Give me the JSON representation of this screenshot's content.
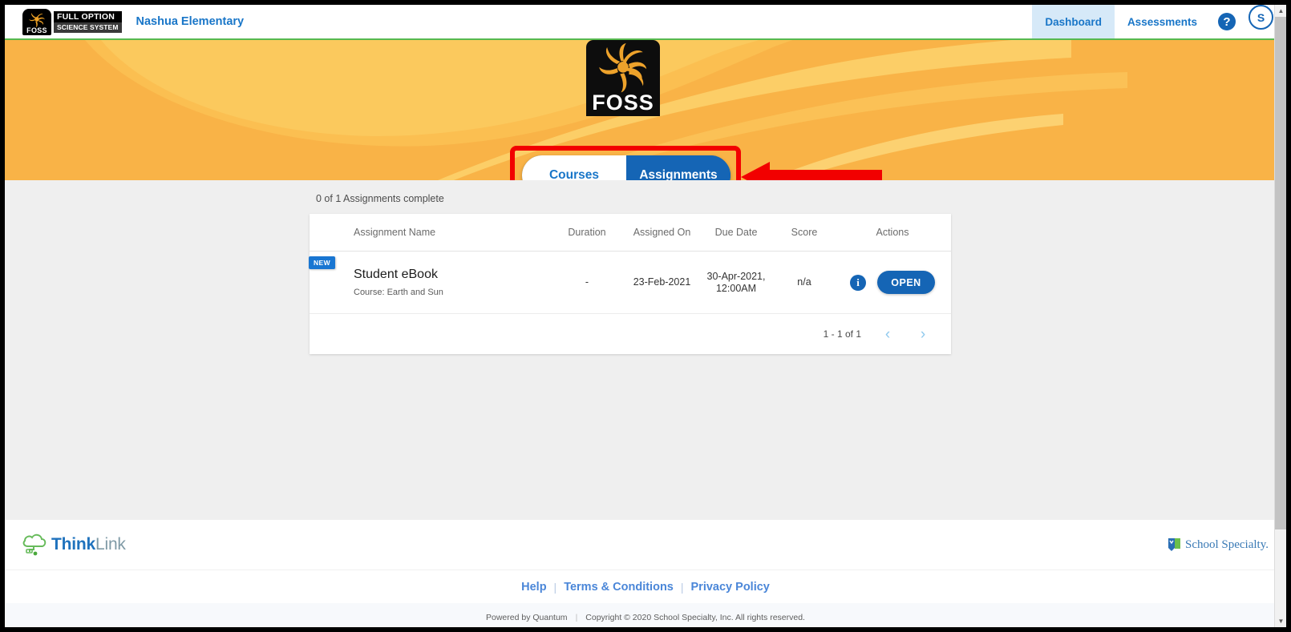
{
  "topnav": {
    "brand": {
      "badge_label": "FOSS",
      "word_top": "FULL OPTION",
      "word_bottom": "SCIENCE SYSTEM",
      "sun_icon": "sun-swirl-icon"
    },
    "school_name": "Nashua Elementary",
    "links": [
      {
        "label": "Dashboard",
        "active": true
      },
      {
        "label": "Assessments",
        "active": false
      }
    ],
    "help_icon": "question-mark-icon",
    "help_glyph": "?",
    "avatar_initial": "S"
  },
  "banner": {
    "logo_text": "FOSS",
    "logo_sun_icon": "sun-swirl-icon",
    "background_color": "#f9b347",
    "wave_color": "#fcd06a",
    "divider_color": "#56b94f",
    "tabs": [
      {
        "label": "Courses",
        "active": false
      },
      {
        "label": "Assignments",
        "active": true
      }
    ]
  },
  "annotation": {
    "highlight_color": "#f20000",
    "arrow_icon": "left-arrow-icon"
  },
  "main": {
    "status_text": "0 of 1 Assignments complete",
    "columns": [
      "Assignment Name",
      "Duration",
      "Assigned On",
      "Due Date",
      "Score",
      "Actions"
    ],
    "rows": [
      {
        "badge": "NEW",
        "name": "Student eBook",
        "course": "Course: Earth and Sun",
        "duration": "-",
        "assigned_on": "23-Feb-2021",
        "due_date_line1": "30-Apr-2021,",
        "due_date_line2": "12:00AM",
        "score": "n/a",
        "info_icon": "info-circle-icon",
        "info_glyph": "i",
        "action_label": "OPEN"
      }
    ],
    "pagination": {
      "range": "1 - 1 of 1",
      "prev_icon": "chevron-left-icon",
      "prev_glyph": "‹",
      "next_icon": "chevron-right-icon",
      "next_glyph": "›"
    }
  },
  "footer": {
    "thinklink": {
      "part1": "Think",
      "part2": "Link",
      "cloud_icon": "cloud-icon"
    },
    "school_specialty": {
      "label": "School Specialty.",
      "mark_icon": "shield-mark-icon"
    },
    "links": [
      {
        "label": "Help"
      },
      {
        "label": "Terms & Conditions"
      },
      {
        "label": "Privacy Policy"
      }
    ],
    "separator": "|",
    "powered_by": "Powered by Quantum",
    "copyright": "Copyright © 2020 School Specialty, Inc. All rights reserved."
  },
  "scrollbar": {
    "up_glyph": "▲",
    "down_glyph": "▼"
  }
}
